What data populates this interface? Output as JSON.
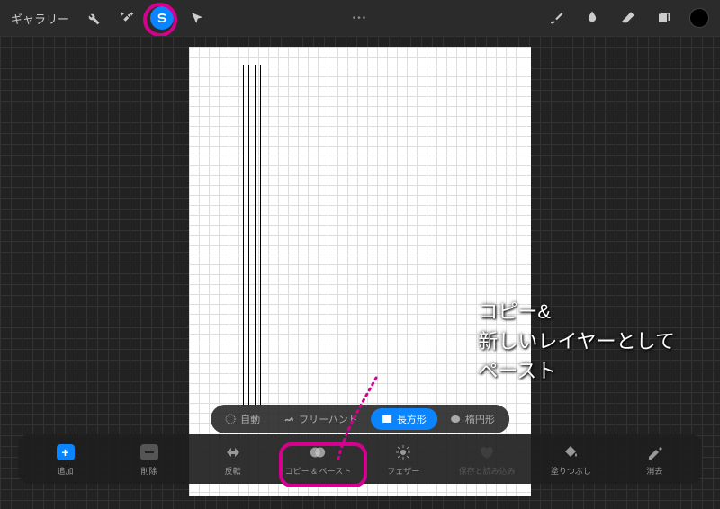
{
  "topbar": {
    "gallery": "ギャラリー",
    "dots": "•••"
  },
  "selection": {
    "auto": "自動",
    "freehand": "フリーハンド",
    "rectangle": "長方形",
    "ellipse": "楕円形"
  },
  "actions": {
    "add": "追加",
    "remove": "削除",
    "flip": "反転",
    "copypaste": "コピー & ペースト",
    "feather": "フェザー",
    "saveload": "保存と読み込み",
    "colorfill": "塗りつぶし",
    "clear": "消去"
  },
  "annotation": {
    "text": "コピー&\n新しいレイヤーとして\nペースト"
  }
}
